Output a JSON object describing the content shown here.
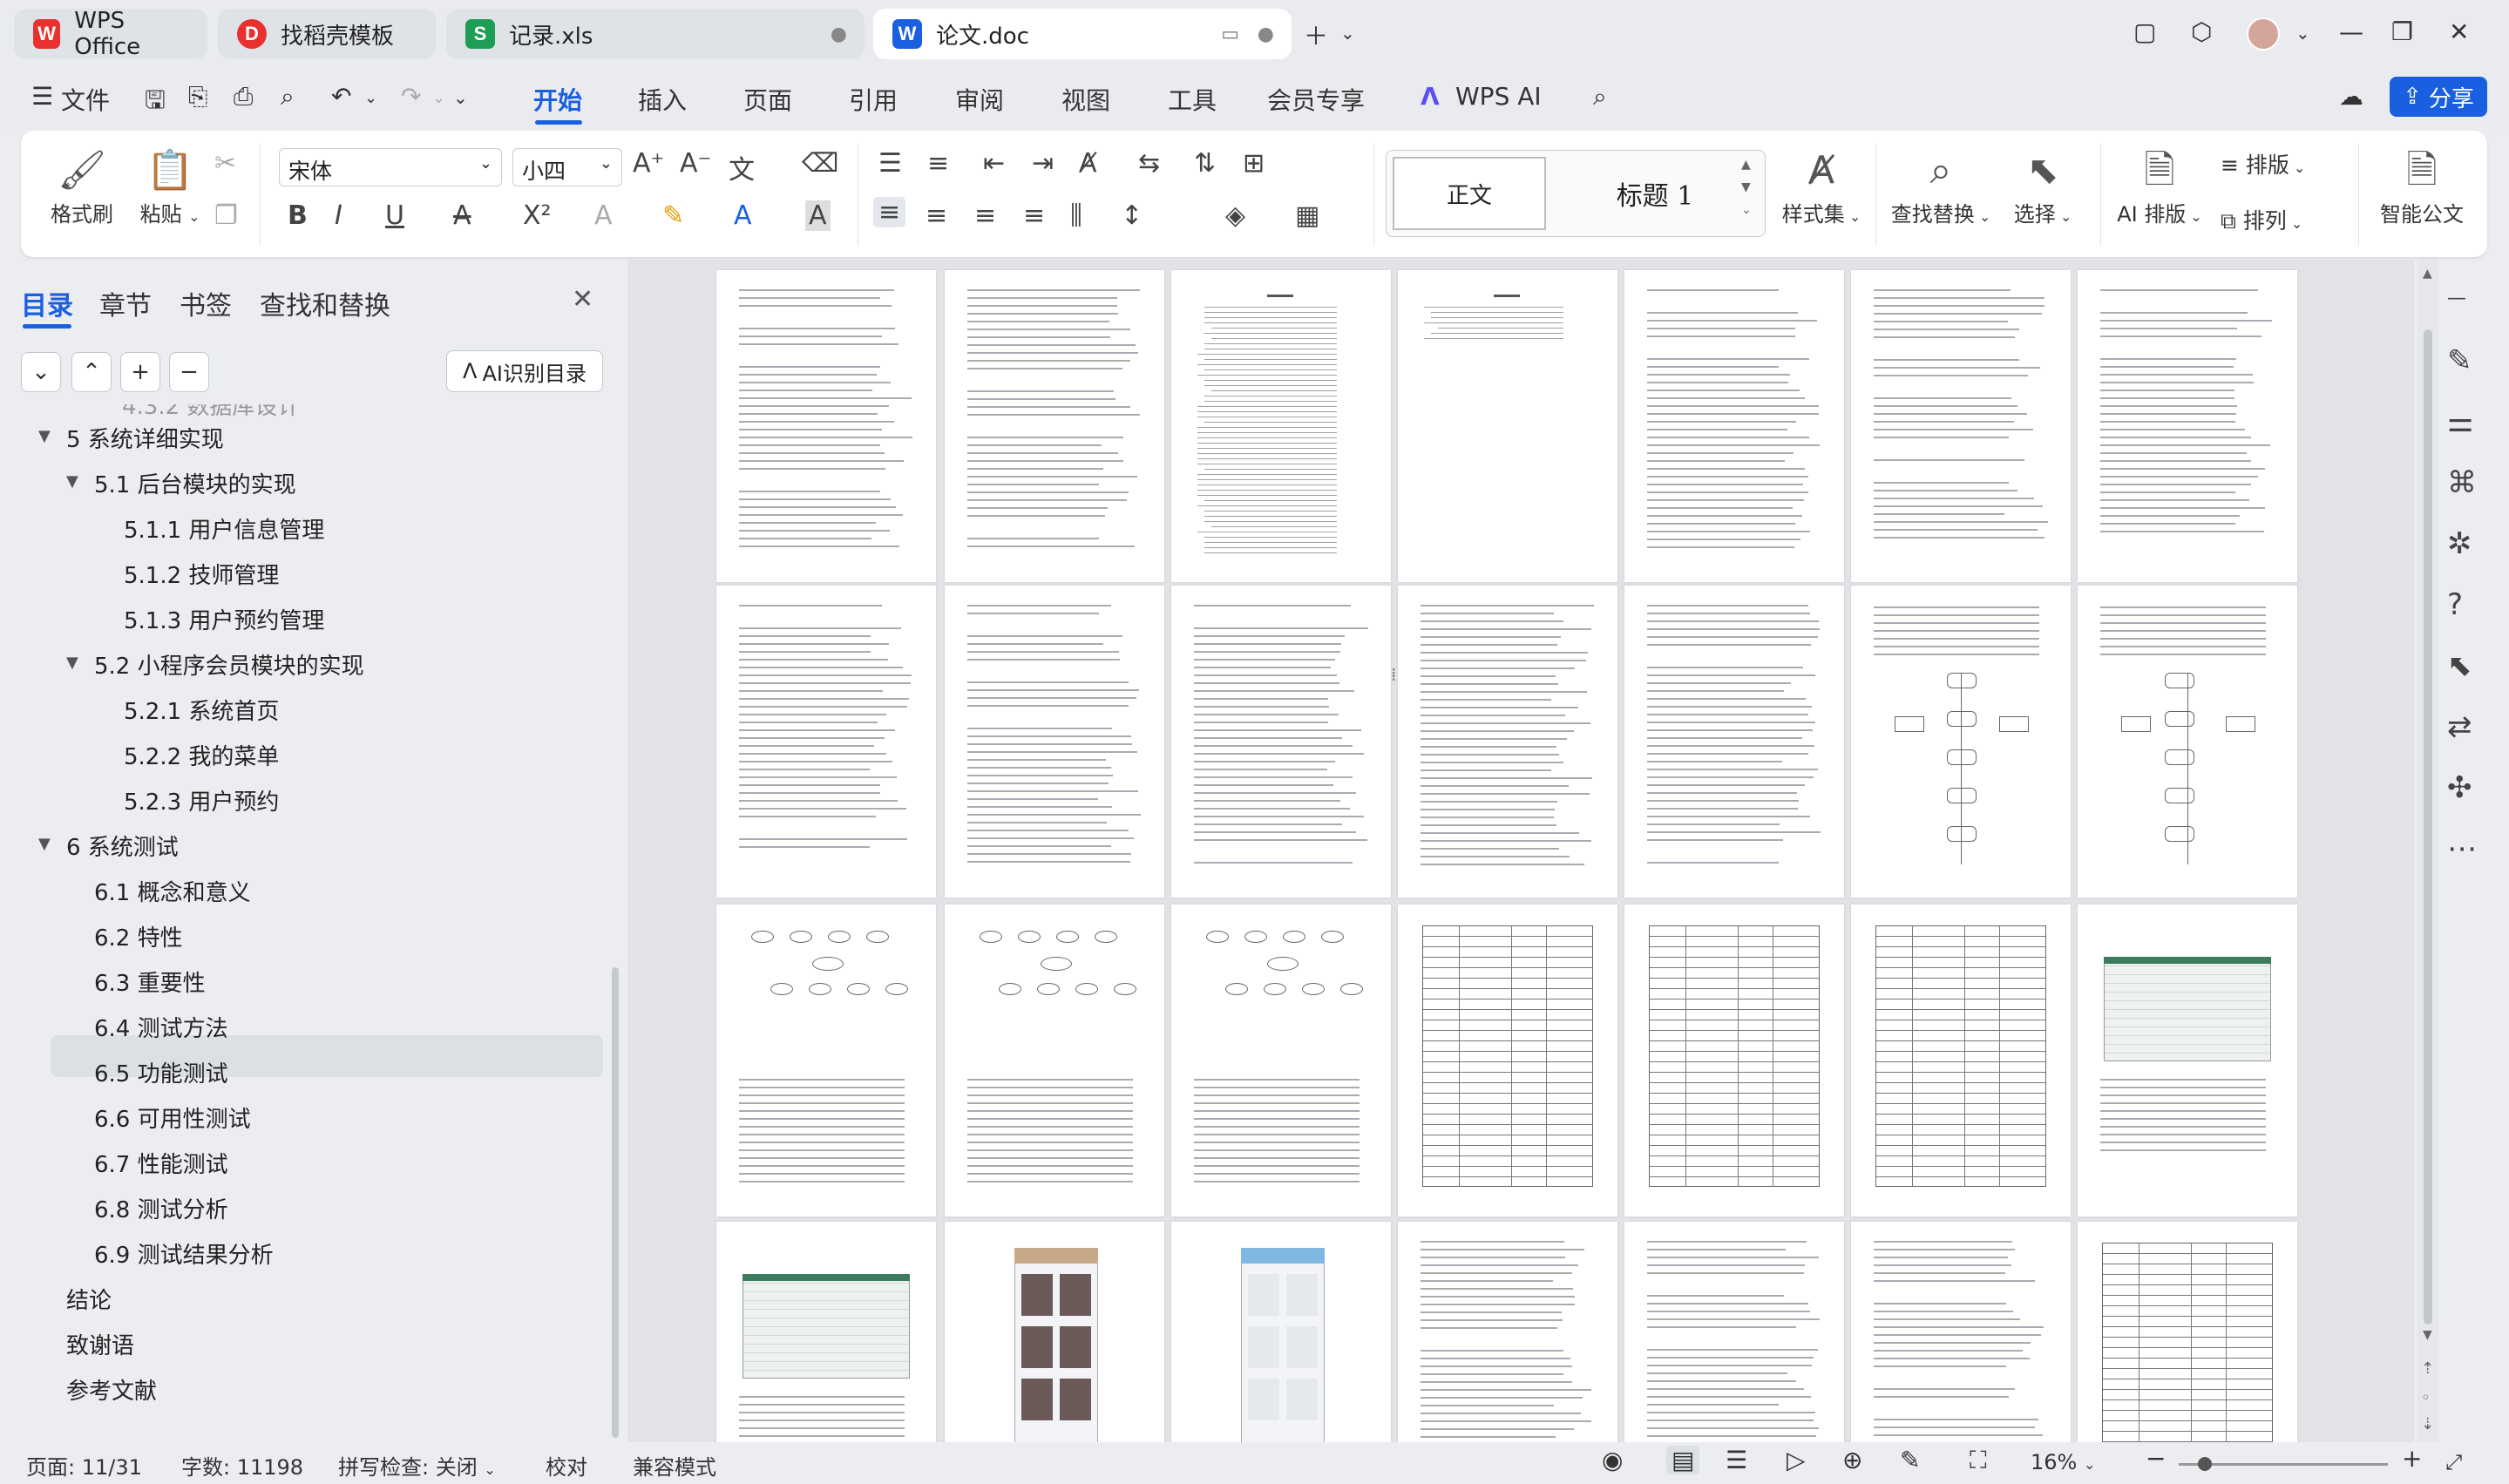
{
  "tabs": [
    {
      "label": "WPS Office",
      "icon": "W"
    },
    {
      "label": "找稻壳模板",
      "icon": "D"
    },
    {
      "label": "记录.xls",
      "icon": "S"
    },
    {
      "label": "论文.doc",
      "icon": "W"
    }
  ],
  "menu": {
    "file": "文件",
    "items": [
      "开始",
      "插入",
      "页面",
      "引用",
      "审阅",
      "视图",
      "工具",
      "会员专享",
      "WPS AI"
    ],
    "share": "分享"
  },
  "ribbon": {
    "format_painter": "格式刷",
    "paste": "粘贴",
    "font_name": "宋体",
    "font_size": "小四",
    "style_normal": "正文",
    "style_heading": "标题 1",
    "style_set": "样式集",
    "find_replace": "查找替换",
    "select": "选择",
    "ai_layout": "AI 排版",
    "layout": "排版",
    "arrange": "排列",
    "smart_doc": "智能公文"
  },
  "sidebar": {
    "tabs": [
      "目录",
      "章节",
      "书签",
      "查找和替换"
    ],
    "ai_button": "AI识别目录",
    "toc": [
      {
        "text": "5 系统详细实现",
        "level": 1,
        "expandable": true
      },
      {
        "text": "5.1  后台模块的实现",
        "level": 2,
        "expandable": true
      },
      {
        "text": "5.1.1  用户信息管理",
        "level": 3
      },
      {
        "text": "5.1.2  技师管理",
        "level": 3
      },
      {
        "text": "5.1.3  用户预约管理",
        "level": 3
      },
      {
        "text": "5.2  小程序会员模块的实现",
        "level": 2,
        "expandable": true
      },
      {
        "text": "5.2.1  系统首页",
        "level": 3
      },
      {
        "text": "5.2.2  我的菜单",
        "level": 3
      },
      {
        "text": "5.2.3  用户预约",
        "level": 3
      },
      {
        "text": "6 系统测试",
        "level": 1,
        "expandable": true
      },
      {
        "text": "6.1 概念和意义",
        "level": 2
      },
      {
        "text": "6.2 特性",
        "level": 2
      },
      {
        "text": "6.3 重要性",
        "level": 2
      },
      {
        "text": "6.4 测试方法",
        "level": 2,
        "selected": true
      },
      {
        "text": "6.5  功能测试",
        "level": 2
      },
      {
        "text": "6.6 可用性测试",
        "level": 2
      },
      {
        "text": "6.7 性能测试",
        "level": 2
      },
      {
        "text": "6.8 测试分析",
        "level": 2
      },
      {
        "text": "6.9 测试结果分析",
        "level": 2
      },
      {
        "text": "结论",
        "level": 0
      },
      {
        "text": "致谢语",
        "level": 0
      },
      {
        "text": "参考文献",
        "level": 0
      }
    ]
  },
  "status": {
    "page": "页面: 11/31",
    "words": "字数: 11198",
    "spell": "拼写检查: 关闭",
    "proof": "校对",
    "compat": "兼容模式",
    "zoom": "16%"
  },
  "colors": {
    "accent": "#1a5fe0",
    "wps_red": "#e8312f",
    "excel_green": "#1d9e54"
  }
}
